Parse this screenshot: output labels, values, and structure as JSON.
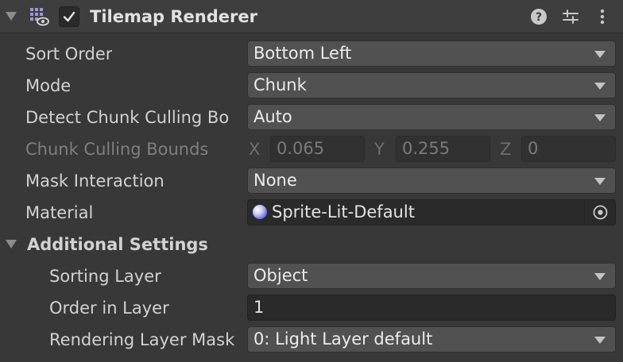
{
  "header": {
    "title": "Tilemap Renderer",
    "enabled": true,
    "icons": [
      "foldout-arrow-icon",
      "tilemap-renderer-icon",
      "checkbox-check-icon",
      "help-icon",
      "presets-icon",
      "more-options-icon"
    ]
  },
  "rows": {
    "sort_order": {
      "label": "Sort Order",
      "value": "Bottom Left"
    },
    "mode": {
      "label": "Mode",
      "value": "Chunk"
    },
    "detect_chunk": {
      "label": "Detect Chunk Culling Bo",
      "value": "Auto"
    },
    "chunk_bounds": {
      "label": "Chunk Culling Bounds",
      "x_label": "X",
      "x": "0.065",
      "y_label": "Y",
      "y": "0.255",
      "z_label": "Z",
      "z": "0"
    },
    "mask_interaction": {
      "label": "Mask Interaction",
      "value": "None"
    },
    "material": {
      "label": "Material",
      "value": "Sprite-Lit-Default"
    }
  },
  "additional": {
    "title": "Additional Settings",
    "sorting_layer": {
      "label": "Sorting Layer",
      "value": "Object"
    },
    "order_in_layer": {
      "label": "Order in Layer",
      "value": "1"
    },
    "rendering_layer_mask": {
      "label": "Rendering Layer Mask",
      "value": "0: Light Layer default"
    }
  },
  "colors": {
    "background": "#383838",
    "header": "#3e3e3e",
    "dropdown": "#515151",
    "field": "#2a2a2a",
    "text": "#d2d2d2",
    "disabled_text": "#7f7f7f"
  }
}
